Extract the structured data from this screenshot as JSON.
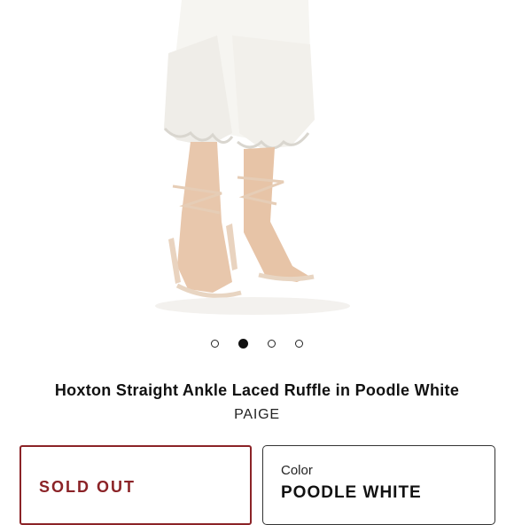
{
  "product": {
    "title": "Hoxton Straight Ankle Laced Ruffle in Poodle White",
    "brand": "PAIGE"
  },
  "carousel": {
    "total": 4,
    "active_index": 2
  },
  "availability": {
    "status_label": "SOLD OUT",
    "accent_color": "#8b2327"
  },
  "color_selector": {
    "label": "Color",
    "value": "POODLE WHITE"
  }
}
